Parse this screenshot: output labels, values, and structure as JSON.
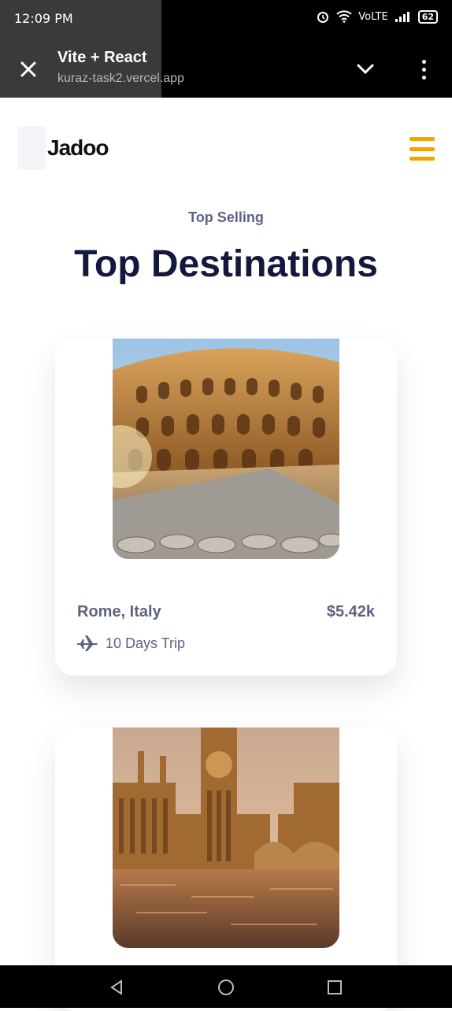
{
  "status_bar": {
    "time": "12:09 PM",
    "network": "VoLTE",
    "battery": "62"
  },
  "browser": {
    "title": "Vite + React",
    "url": "kuraz-task2.vercel.app"
  },
  "header": {
    "logo": "Jadoo",
    "menu_icon": "hamburger-icon",
    "accent_color": "#f1a501"
  },
  "section": {
    "subtitle": "Top Selling",
    "title": "Top Destinations"
  },
  "destinations": [
    {
      "name": "Rome, Italy",
      "price": "$5.42k",
      "trip": "10 Days Trip",
      "image": "colosseum"
    },
    {
      "name": "",
      "price": "",
      "trip": "",
      "image": "big-ben-london"
    }
  ],
  "colors": {
    "title": "#14183e",
    "text": "#5e6282"
  }
}
